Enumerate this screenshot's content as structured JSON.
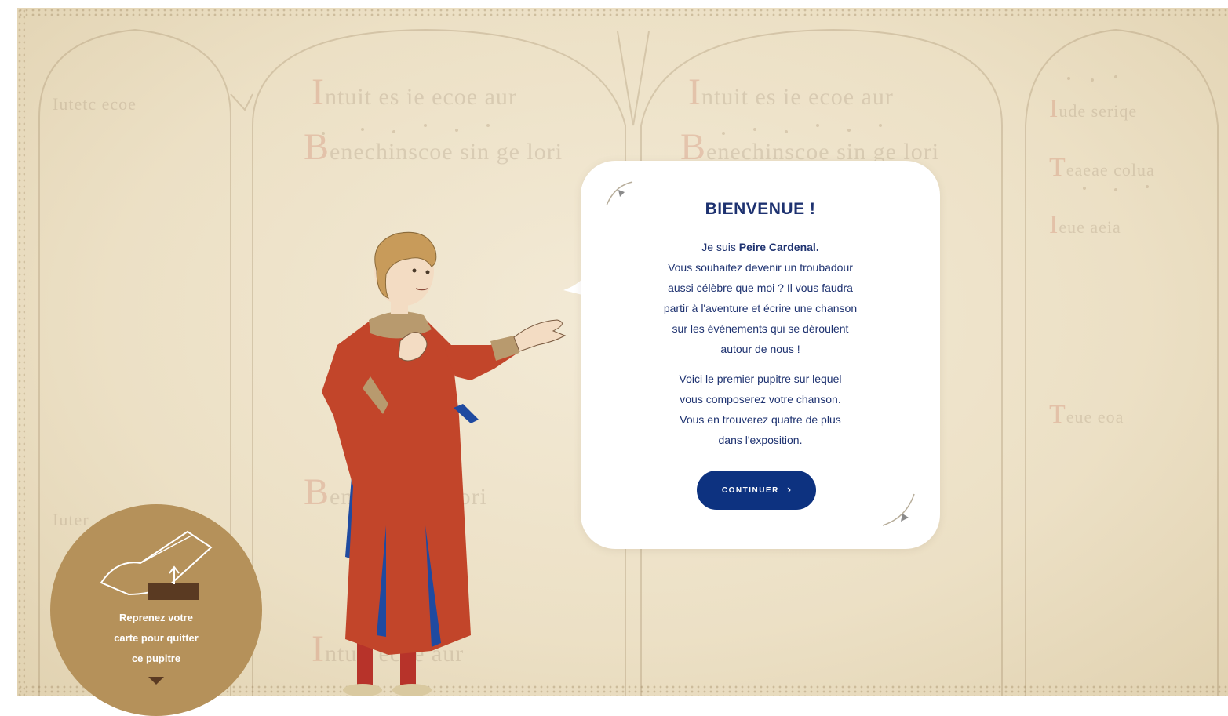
{
  "bubble": {
    "title": "BIENVENUE !",
    "intro_prefix": "Je suis ",
    "intro_name": "Peire Cardenal.",
    "line_2": "Vous souhaitez devenir un troubadour",
    "line_3": "aussi célèbre que moi ? Il vous faudra",
    "line_4": "partir à l'aventure et écrire une chanson",
    "line_5": "sur les événements qui se déroulent",
    "line_6": "autour de nous !",
    "para2_line_1": "Voici le premier pupitre sur lequel",
    "para2_line_2": "vous composerez votre chanson.",
    "para2_line_3": "Vous en trouverez quatre de plus",
    "para2_line_4": "dans l'exposition.",
    "continue_label": "CONTINUER",
    "continue_icon": "chevron-right-icon"
  },
  "exit_badge": {
    "line_1": "Reprenez votre",
    "line_2": "carte pour quitter",
    "line_3": "ce pupitre",
    "icon": "hand-card-icon"
  },
  "colors": {
    "background": "#ece0c5",
    "navy": "#0d3280",
    "text_navy": "#1e3270",
    "gold": "#b5915a",
    "robe_red": "#c2452a",
    "robe_blue": "#1f4aa0"
  }
}
